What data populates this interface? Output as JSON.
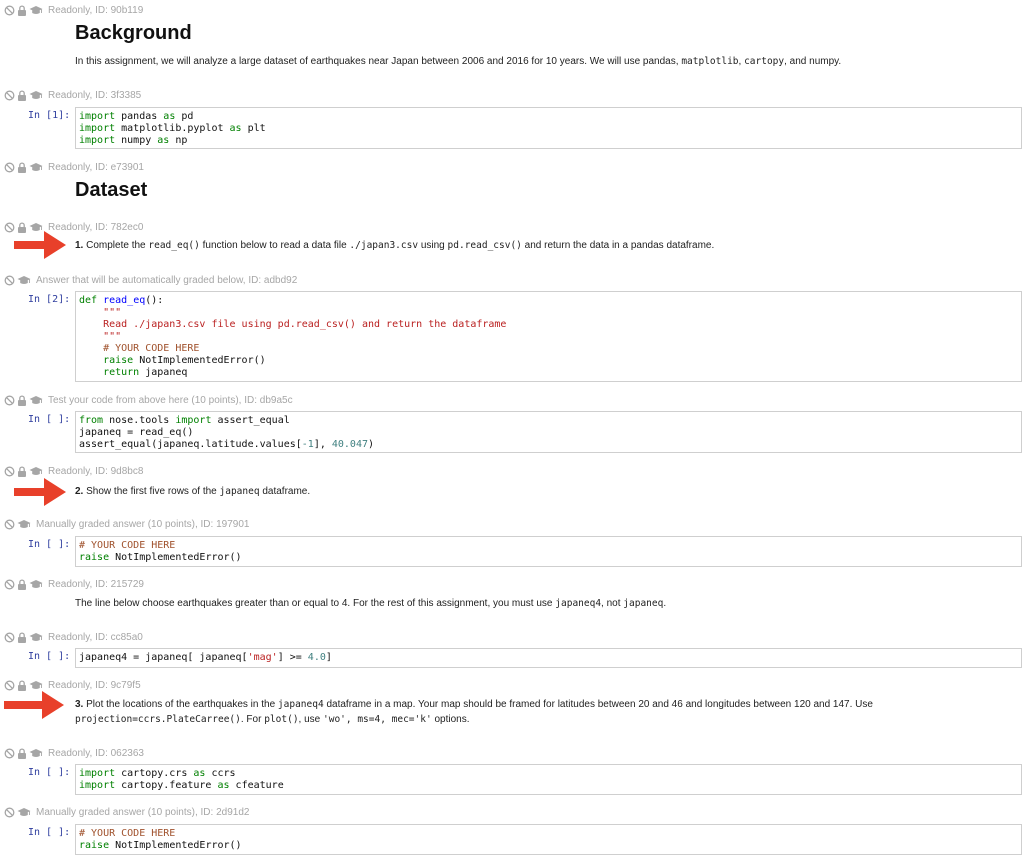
{
  "cells": [
    {
      "meta": "Readonly, ID: 90b119"
    },
    {
      "meta": "Readonly, ID: 3f3385"
    },
    {
      "meta": "Readonly, ID: e73901"
    },
    {
      "meta": "Readonly, ID: 782ec0"
    },
    {
      "meta": "Answer that will be automatically graded below, ID: adbd92"
    },
    {
      "meta": "Test your code from above here (10 points), ID: db9a5c"
    },
    {
      "meta": "Readonly, ID: 9d8bc8"
    },
    {
      "meta": "Manually graded answer (10 points), ID: 197901"
    },
    {
      "meta": "Readonly, ID: 215729"
    },
    {
      "meta": "Readonly, ID: cc85a0"
    },
    {
      "meta": "Readonly, ID: 9c79f5"
    },
    {
      "meta": "Readonly, ID: 062363"
    },
    {
      "meta": "Manually graded answer (10 points), ID: 2d91d2"
    }
  ],
  "headings": {
    "background": "Background",
    "dataset": "Dataset"
  },
  "text": {
    "intro_a": "In this assignment, we will analyze a large dataset of earthquakes near Japan between 2006 and 2016 for 10 years. We will use pandas, ",
    "intro_b": "matplotlib",
    "intro_c": ", ",
    "intro_d": "cartopy",
    "intro_e": ", and numpy.",
    "q1_num": "1.",
    "q1_a": " Complete the ",
    "q1_b": "read_eq()",
    "q1_c": " function below to read a data file ",
    "q1_d": "./japan3.csv",
    "q1_e": " using ",
    "q1_f": "pd.read_csv()",
    "q1_g": " and return the data in a pandas dataframe.",
    "q2_num": "2.",
    "q2_a": " Show the first five rows of the ",
    "q2_b": "japaneq",
    "q2_c": " dataframe.",
    "mid_a": "The line below choose earthquakes greater than or equal to 4. For the rest of this assignment, you must use ",
    "mid_b": "japaneq4",
    "mid_c": ", not ",
    "mid_d": "japaneq",
    "mid_e": ".",
    "q3_num": "3.",
    "q3_a": " Plot the locations of the earthquakes in the ",
    "q3_b": "japaneq4",
    "q3_c": " dataframe in a map. Your map should be framed for latitudes between 20 and 46 and longitudes between 120 and 147. Use",
    "q3_d": "projection=ccrs.PlateCarree()",
    "q3_e": ". For ",
    "q3_f": "plot()",
    "q3_g": ", use ",
    "q3_h": "'wo', ms=4, mec='k'",
    "q3_i": " options."
  },
  "prompts": {
    "p1": "In [1]:",
    "p2": "In [2]:",
    "p3": "In [ ]:",
    "p4": "In [ ]:",
    "p5": "In [ ]:",
    "p6": "In [ ]:",
    "p7": "In [ ]:"
  },
  "code": {
    "c1_l1a": "import",
    "c1_l1b": " pandas ",
    "c1_l1c": "as",
    "c1_l1d": " pd",
    "c1_l2a": "import",
    "c1_l2b": " matplotlib.pyplot ",
    "c1_l2c": "as",
    "c1_l2d": " plt",
    "c1_l3a": "import",
    "c1_l3b": " numpy ",
    "c1_l3c": "as",
    "c1_l3d": " np",
    "c2_l1a": "def",
    "c2_l1b": " ",
    "c2_l1c": "read_eq",
    "c2_l1d": "():",
    "c2_l2": "    \"\"\"",
    "c2_l3": "    Read ./japan3.csv file using pd.read_csv() and return the dataframe",
    "c2_l4": "    \"\"\"",
    "c2_l5": "    # YOUR CODE HERE",
    "c2_l6a": "    raise",
    "c2_l6b": " NotImplementedError()",
    "c2_l7a": "    return",
    "c2_l7b": " japaneq",
    "c3_l1a": "from",
    "c3_l1b": " nose.tools ",
    "c3_l1c": "import",
    "c3_l1d": " assert_equal",
    "c3_l2": "japaneq = read_eq()",
    "c3_l3a": "assert_equal(japaneq.latitude.values[",
    "c3_l3b": "-1",
    "c3_l3c": "], ",
    "c3_l3d": "40.047",
    "c3_l3e": ")",
    "c4_l1": "# YOUR CODE HERE",
    "c4_l2a": "raise",
    "c4_l2b": " NotImplementedError()",
    "c5_l1a": "japaneq4 = japaneq[ japaneq[",
    "c5_l1b": "'mag'",
    "c5_l1c": "] >= ",
    "c5_l1d": "4.0",
    "c5_l1e": "]",
    "c6_l1a": "import",
    "c6_l1b": " cartopy.crs ",
    "c6_l1c": "as",
    "c6_l1d": " ccrs",
    "c6_l2a": "import",
    "c6_l2b": " cartopy.feature ",
    "c6_l2c": "as",
    "c6_l2d": " cfeature",
    "c7_l1": "# YOUR CODE HERE",
    "c7_l2a": "raise",
    "c7_l2b": " NotImplementedError()"
  },
  "colors": {
    "arrow": "#e8402a",
    "prompt": "#303f9f",
    "meta": "#a6a6a6"
  }
}
